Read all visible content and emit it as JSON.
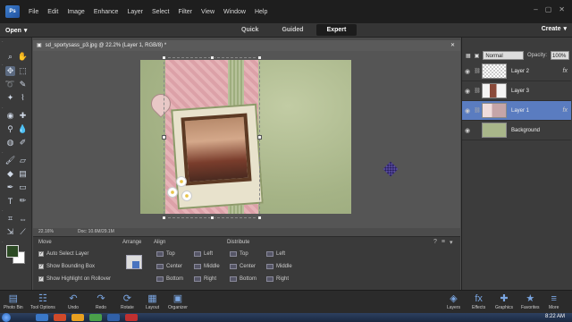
{
  "menubar": {
    "logo": "Ps",
    "items": [
      "File",
      "Edit",
      "Image",
      "Enhance",
      "Layer",
      "Select",
      "Filter",
      "View",
      "Window",
      "Help"
    ]
  },
  "modebar": {
    "open_label": "Open",
    "modes": [
      "Quick",
      "Guided",
      "Expert"
    ],
    "active_mode": "Expert",
    "create_label": "Create"
  },
  "document": {
    "tab_title": "sd_sportysass_p3.jpg @ 22.2% (Layer 1, RGB/8) *",
    "zoom": "22.16%",
    "doc_size": "Doc: 10.6M/29.1M"
  },
  "tool_options": {
    "move_title": "Move",
    "checks": [
      {
        "label": "Auto Select Layer",
        "checked": true
      },
      {
        "label": "Show Bounding Box",
        "checked": true
      },
      {
        "label": "Show Highlight on Rollover",
        "checked": true
      }
    ],
    "arrange_title": "Arrange",
    "align_title": "Align",
    "align": [
      "Top",
      "Center",
      "Bottom",
      "Left",
      "Middle",
      "Right"
    ],
    "distribute_title": "Distribute",
    "distribute": [
      "Top",
      "Center",
      "Bottom",
      "Left",
      "Middle",
      "Right"
    ]
  },
  "layers": {
    "blend_mode": "Normal",
    "opacity_label": "Opacity:",
    "opacity_value": "100%",
    "items": [
      {
        "name": "Layer 2",
        "fx": true,
        "active": false
      },
      {
        "name": "Layer 3",
        "fx": false,
        "active": false
      },
      {
        "name": "Layer 1",
        "fx": true,
        "active": true
      },
      {
        "name": "Background",
        "fx": false,
        "active": false
      }
    ]
  },
  "dock": {
    "left": [
      "Photo Bin",
      "Tool Options",
      "Undo",
      "Redo",
      "Rotate",
      "Layout",
      "Organizer"
    ],
    "right": [
      "Layers",
      "Effects",
      "Graphics",
      "Favorites",
      "More"
    ]
  },
  "taskbar": {
    "clock": "8:22 AM"
  },
  "colors": {
    "foreground": "#2c4a24",
    "background": "#ffffff",
    "active_layer": "#5a7cc0"
  }
}
